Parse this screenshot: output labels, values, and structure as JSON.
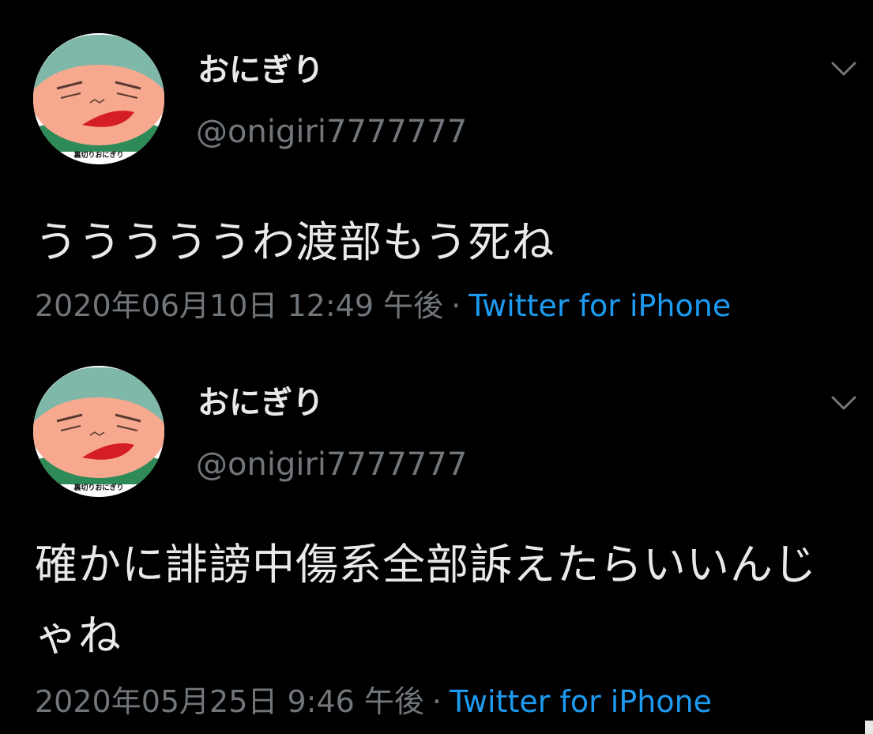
{
  "tweets": [
    {
      "display_name": "おにぎり",
      "handle": "@onigiri7777777",
      "avatar_caption": "裏切りおにぎり",
      "text": "うううううわ渡部もう死ね",
      "timestamp": "2020年06月10日 12:49 午後",
      "separator": "·",
      "source": "Twitter for iPhone",
      "menu_icon": "chevron-down-icon"
    },
    {
      "display_name": "おにぎり",
      "handle": "@onigiri7777777",
      "avatar_caption": "裏切りおにぎり",
      "text": "確かに誹謗中傷系全部訴えたらいいんじゃね",
      "timestamp": "2020年05月25日 9:46 午後",
      "separator": "·",
      "source": "Twitter for iPhone",
      "menu_icon": "chevron-down-icon"
    }
  ],
  "colors": {
    "background": "#000000",
    "primary_text": "#e7e9ea",
    "secondary_text": "#71767b",
    "link": "#1d9bf0"
  }
}
